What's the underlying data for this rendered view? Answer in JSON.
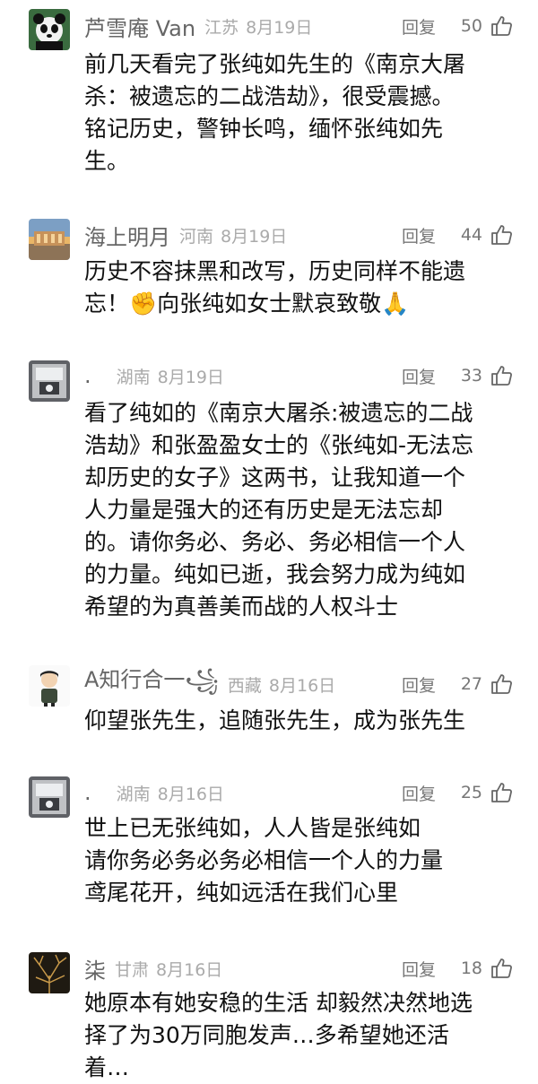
{
  "reply_label": "回复",
  "comments": [
    {
      "name": "芦雪庵 Van",
      "region": "江苏",
      "date": "8月19日",
      "likes": "50",
      "lines": [
        "前几天看完了张纯如先生的《南京大屠",
        "杀：被遗忘的二战浩劫》，很受震撼。",
        "铭记历史，警钟长鸣，缅怀张纯如先",
        "生。"
      ]
    },
    {
      "name": "海上明月",
      "region": "河南",
      "date": "8月19日",
      "likes": "44",
      "lines": [
        "历史不容抹黑和改写，历史同样不能遗",
        "忘！✊向张纯如女士默哀致敬🙏"
      ]
    },
    {
      "name": ".",
      "region": "湖南",
      "date": "8月19日",
      "likes": "33",
      "lines": [
        "看了纯如的《南京大屠杀:被遗忘的二战",
        "浩劫》和张盈盈女士的《张纯如-无法忘",
        "却历史的女子》这两书，让我知道一个",
        "人力量是强大的还有历史是无法忘却",
        "的。请你务必、务必、务必相信一个人",
        "的力量。纯如已逝，我会努力成为纯如",
        "希望的为真善美而战的人权斗士"
      ]
    },
    {
      "name": "A知行合一꧁",
      "region": "西藏",
      "date": "8月16日",
      "likes": "27",
      "lines": [
        "仰望张先生，追随张先生，成为张先生"
      ]
    },
    {
      "name": ".",
      "region": "湖南",
      "date": "8月16日",
      "likes": "25",
      "lines": [
        "世上已无张纯如，人人皆是张纯如",
        "请你务必务必务必相信一个人的力量",
        "鸢尾花开，纯如远活在我们心里"
      ]
    },
    {
      "name": "柒",
      "region": "甘肃",
      "date": "8月16日",
      "likes": "18",
      "lines": [
        "她原本有她安稳的生活 却毅然决然地选",
        "择了为30万同胞发声…多希望她还活",
        "着…"
      ]
    }
  ]
}
